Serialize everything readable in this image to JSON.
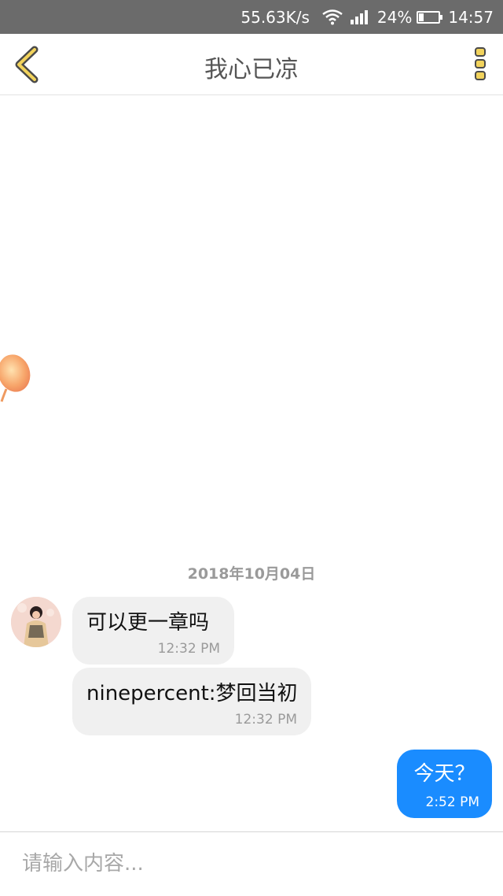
{
  "status_bar": {
    "network_speed": "55.63K/s",
    "battery": "24%",
    "time": "14:57"
  },
  "header": {
    "title": "我心已凉",
    "accent_color": "#f2d35c"
  },
  "chat": {
    "date": "2018年10月04日",
    "messages": [
      {
        "text": "可以更一章吗",
        "time": "12:32 PM",
        "direction": "incoming"
      },
      {
        "text": "ninepercent:梦回当初",
        "time": "12:32 PM",
        "direction": "incoming"
      },
      {
        "text": "今天？",
        "time": "2:52 PM",
        "direction": "outgoing"
      }
    ]
  },
  "input": {
    "placeholder": "请输入内容..."
  },
  "colors": {
    "outgoing_bubble": "#1a8cff",
    "incoming_bubble": "#f0f0f0",
    "status_bar": "#6b6b6b"
  }
}
